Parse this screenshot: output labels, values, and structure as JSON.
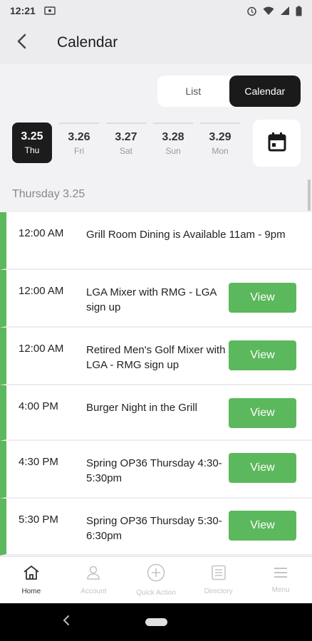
{
  "status_bar": {
    "time": "12:21",
    "left_icon": "cast-icon",
    "right_icons": [
      "alarm-icon",
      "wifi-icon",
      "signal-icon",
      "battery-icon"
    ]
  },
  "header": {
    "title": "Calendar",
    "back_icon": "chevron-left-icon"
  },
  "view_toggle": {
    "list_label": "List",
    "calendar_label": "Calendar",
    "active": "calendar"
  },
  "date_strip": [
    {
      "date": "3.25",
      "day": "Thu",
      "active": true
    },
    {
      "date": "3.26",
      "day": "Fri",
      "active": false
    },
    {
      "date": "3.27",
      "day": "Sat",
      "active": false
    },
    {
      "date": "3.28",
      "day": "Sun",
      "active": false
    },
    {
      "date": "3.29",
      "day": "Mon",
      "active": false
    }
  ],
  "calendar_button_icon": "calendar-icon",
  "day_heading": "Thursday 3.25",
  "events": [
    {
      "time": "12:00 AM",
      "title": "Grill Room Dining is Available 11am - 9pm",
      "has_view": false
    },
    {
      "time": "12:00 AM",
      "title": "LGA Mixer with RMG - LGA sign up",
      "has_view": true
    },
    {
      "time": "12:00 AM",
      "title": "Retired Men's Golf Mixer with LGA - RMG sign up",
      "has_view": true
    },
    {
      "time": "4:00 PM",
      "title": "Burger Night in the Grill",
      "has_view": true
    },
    {
      "time": "4:30 PM",
      "title": "Spring OP36 Thursday 4:30-5:30pm",
      "has_view": true
    },
    {
      "time": "5:30 PM",
      "title": "Spring OP36 Thursday 5:30-6:30pm",
      "has_view": true
    }
  ],
  "view_label": "View",
  "bottom_nav": [
    {
      "label": "Home",
      "icon": "home-icon",
      "active": true
    },
    {
      "label": "Account",
      "icon": "user-icon",
      "active": false
    },
    {
      "label": "Quick Action",
      "icon": "plus-circle-icon",
      "active": false
    },
    {
      "label": "Directory",
      "icon": "directory-icon",
      "active": false
    },
    {
      "label": "Menu",
      "icon": "hamburger-icon",
      "active": false
    }
  ],
  "colors": {
    "accent_green": "#5cb85c",
    "active_dark": "#1c1c1c",
    "header_bg": "#ececef"
  }
}
